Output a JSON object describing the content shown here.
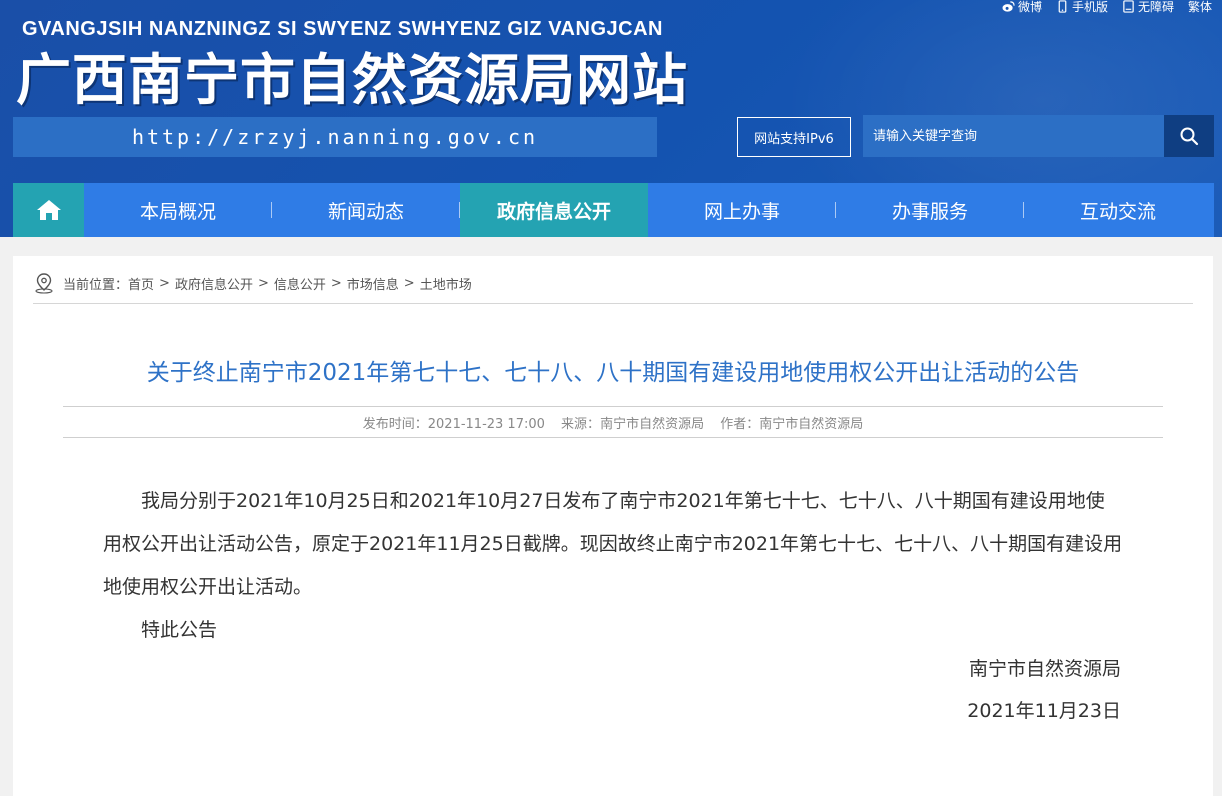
{
  "header": {
    "subtitle": "GVANGJSIH NANZNINGZ SI SWYENZ SWHYENZ GIZ VANGJCAN",
    "title": "广西南宁市自然资源局网站",
    "url": "http://zrzyj.nanning.gov.cn",
    "top_links": [
      {
        "label": "微博",
        "icon": "weibo-icon"
      },
      {
        "label": "手机版",
        "icon": "mobile-icon"
      },
      {
        "label": "无障碍",
        "icon": "accessibility-icon"
      },
      {
        "label": "繁体",
        "icon": ""
      }
    ],
    "ipv6_label": "网站支持IPv6",
    "search_placeholder": "请输入关键字查询"
  },
  "nav": {
    "items": [
      {
        "label": "本局概况"
      },
      {
        "label": "新闻动态"
      },
      {
        "label": "政府信息公开"
      },
      {
        "label": "网上办事"
      },
      {
        "label": "办事服务"
      },
      {
        "label": "互动交流"
      }
    ],
    "active_index": 2
  },
  "breadcrumb": {
    "prefix": "当前位置：",
    "items": [
      "首页",
      "政府信息公开",
      "信息公开",
      "市场信息",
      "土地市场"
    ]
  },
  "article": {
    "title": "关于终止南宁市2021年第七十七、七十八、八十期国有建设用地使用权公开出让活动的公告",
    "publish_label": "发布时间：",
    "publish_time": "2021-11-23 17:00",
    "source_label": "来源：",
    "source": "南宁市自然资源局",
    "author_label": "作者：",
    "author": "南宁市自然资源局",
    "paragraphs": [
      "我局分别于2021年10月25日和2021年10月27日发布了南宁市2021年第七十七、七十八、八十期国有建设用地使用权公开出让活动公告，原定于2021年11月25日截牌。现因故终止南宁市2021年第七十七、七十八、八十期国有建设用地使用权公开出让活动。",
      "特此公告"
    ],
    "signature": "南宁市自然资源局",
    "date": "2021年11月23日"
  },
  "colors": {
    "header_bg": "#1453b0",
    "nav_bg": "#2f7ce6",
    "nav_active": "#24a3b2",
    "title_color": "#2e72c7"
  }
}
